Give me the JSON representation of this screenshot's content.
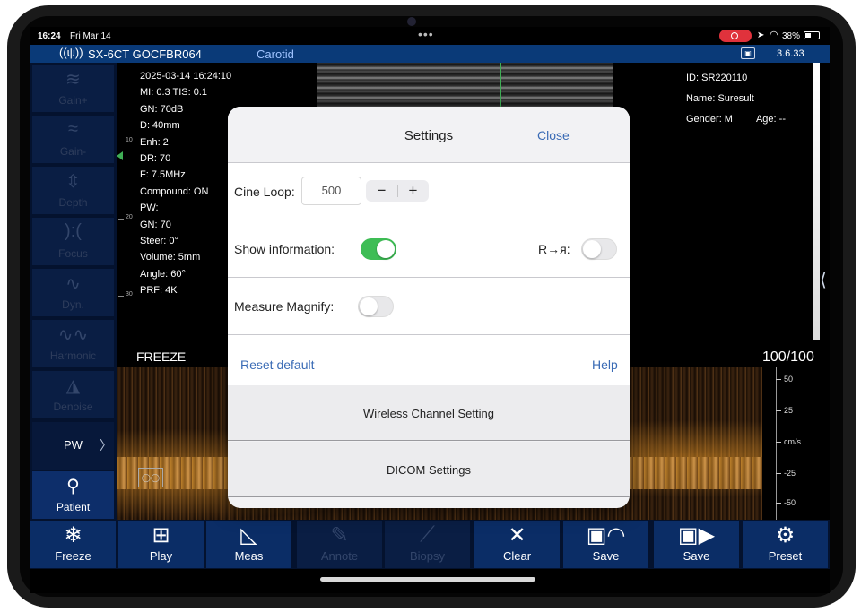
{
  "status_bar": {
    "time": "16:24",
    "date": "Fri Mar 14",
    "battery": "38%"
  },
  "top_bar": {
    "probe": "SX-6CT GOCFBR064",
    "preset": "Carotid",
    "version": "3.6.33"
  },
  "left_panel": {
    "gain_plus": "Gain+",
    "gain_minus": "Gain-",
    "depth": "Depth",
    "focus": "Focus",
    "dyn": "Dyn.",
    "harmonic": "Harmonic",
    "denoise": "Denoise",
    "pw": "PW",
    "patient": "Patient"
  },
  "params": {
    "datetime": "2025-03-14 16:24:10",
    "mi_tis": "MI: 0.3  TIS: 0.1",
    "gn": "GN: 70dB",
    "d": "D: 40mm",
    "enh": "Enh: 2",
    "dr": "DR: 70",
    "f": "F: 7.5MHz",
    "compound": "Compound: ON",
    "pw": "PW:",
    "pw_gn": "GN: 70",
    "steer": "Steer: 0°",
    "volume": "Volume: 5mm",
    "angle": "Angle: 60°",
    "prf": "PRF: 4K"
  },
  "patient": {
    "id": "ID: SR220110",
    "name": "Name: Suresult",
    "gender": "Gender: M",
    "age": "Age: --"
  },
  "depth_scale": [
    "10",
    "20",
    "30"
  ],
  "image": {
    "freeze_label": "FREEZE",
    "depth_ratio": "100/100"
  },
  "velocity_scale": {
    "t50": "50",
    "t25": "25",
    "unit": "cm/s",
    "tm25": "-25",
    "tm50": "-50"
  },
  "settings_modal": {
    "title": "Settings",
    "close": "Close",
    "cine_loop_label": "Cine Loop:",
    "cine_loop_value": "500",
    "minus": "−",
    "plus": "+",
    "show_info_label": "Show information:",
    "show_info_on": true,
    "r_label": "R→я:",
    "r_on": false,
    "measure_magnify_label": "Measure Magnify:",
    "measure_magnify_on": false,
    "reset_default": "Reset default",
    "help": "Help",
    "wireless": "Wireless Channel Setting",
    "dicom": "DICOM Settings"
  },
  "bottom_bar": {
    "freeze": "Freeze",
    "play": "Play",
    "meas": "Meas",
    "annote": "Annote",
    "biopsy": "Biopsy",
    "clear": "Clear",
    "save1": "Save",
    "save2": "Save",
    "preset": "Preset"
  },
  "colors": {
    "accent_blue": "#0a3a78",
    "toggle_on": "#3ebd55",
    "link": "#3a6bb5"
  },
  "icons": {
    "gain_plus": "gain-plus-icon",
    "gain_minus": "gain-minus-icon",
    "depth": "depth-icon",
    "focus": "focus-icon",
    "dyn": "wave-icon",
    "harmonic": "harmonic-icon",
    "denoise": "denoise-icon",
    "patient": "patient-icon",
    "freeze": "snowflake-icon",
    "play": "play-icon",
    "meas": "ruler-icon",
    "annote": "annote-icon",
    "biopsy": "biopsy-icon",
    "clear": "x-icon",
    "save": "save-icon",
    "preset": "gear-icon"
  }
}
